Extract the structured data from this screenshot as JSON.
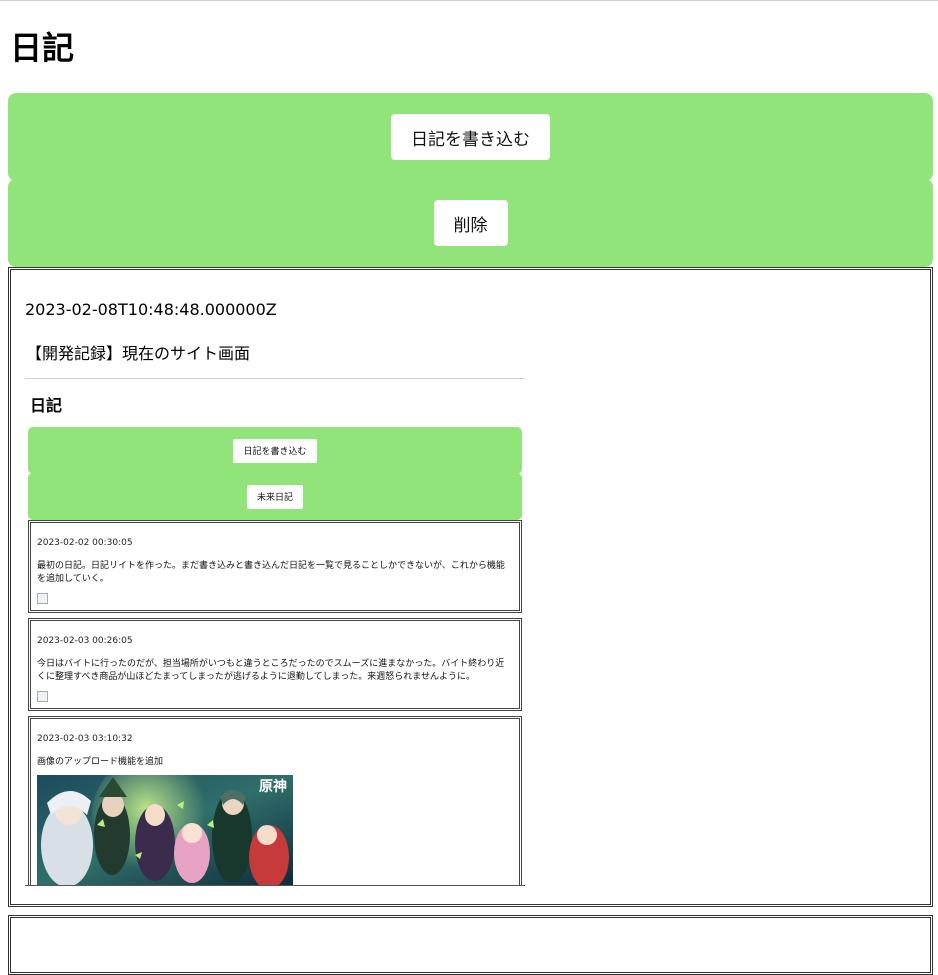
{
  "header": {
    "title": "日記"
  },
  "actions": {
    "write_label": "日記を書き込む",
    "delete_label": "削除"
  },
  "entry": {
    "date": "2023-02-08T10:48:48.000000Z",
    "text": "【開発記録】現在のサイト画面"
  },
  "screenshot": {
    "title": "日記",
    "write_label": "日記を書き込む",
    "future_label": "未来日記",
    "entries": [
      {
        "date": "2023-02-02 00:30:05",
        "text": "最初の日記。日記リイトを作った。まだ書き込みと書き込んだ日記を一覧で見ることしかできないが、これから機能を追加していく。"
      },
      {
        "date": "2023-02-03 00:26:05",
        "text": "今日はバイトに行ったのだが、担当場所がいつもと違うところだったのでスムーズに進まなかった。バイト終わり近くに整理すべき商品が山ほどたまってしまったが逃げるように退勤してしまった。来週怒られませんように。"
      },
      {
        "date": "2023-02-03 03:10:32",
        "text": "画像のアップロード機能を追加"
      }
    ]
  },
  "colors": {
    "accent_green": "#90e47a",
    "border": "#333333"
  }
}
